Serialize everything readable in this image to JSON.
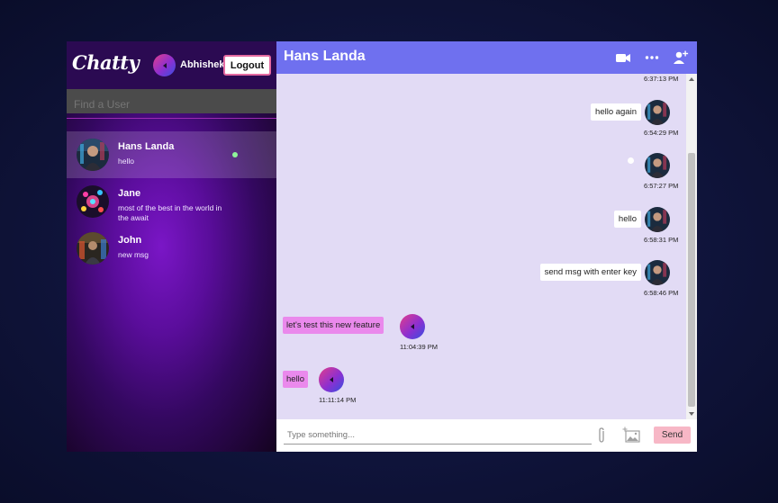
{
  "sidebar": {
    "logo": "Chatty",
    "current_user": "Abhishek",
    "logout_label": "Logout",
    "search_placeholder": "Find a User",
    "contacts": [
      {
        "name": "Hans Landa",
        "last_message": "hello",
        "online": true,
        "active": true
      },
      {
        "name": "Jane",
        "last_message": "most of the best in the world in the await",
        "online": false,
        "active": false
      },
      {
        "name": "John",
        "last_message": "new msg",
        "online": false,
        "active": false
      }
    ]
  },
  "chat": {
    "title": "Hans Landa",
    "header_icons": [
      "video-camera-icon",
      "more-options-icon",
      "add-user-icon"
    ],
    "messages": [
      {
        "direction": "out",
        "text": "",
        "time": "6:37:13 PM"
      },
      {
        "direction": "out",
        "text": "hello again",
        "time": "6:54:29 PM"
      },
      {
        "direction": "out",
        "text": "",
        "time": "6:57:27 PM"
      },
      {
        "direction": "out",
        "text": "hello",
        "time": "6:58:31 PM"
      },
      {
        "direction": "out",
        "text": "send msg with enter key",
        "time": "6:58:46 PM"
      },
      {
        "direction": "in",
        "text": "let's test this new feature",
        "time": "11:04:39 PM"
      },
      {
        "direction": "in",
        "text": "hello",
        "time": "11:11:14 PM"
      }
    ],
    "input_placeholder": "Type something...",
    "send_label": "Send"
  },
  "colors": {
    "header": "#6f70ef",
    "chat_background": "#e2dbf5",
    "incoming_bubble": "#ea89ec",
    "outgoing_bubble": "#ffffff",
    "send_button": "#f7b7c6",
    "online_dot": "#8ff49a"
  }
}
